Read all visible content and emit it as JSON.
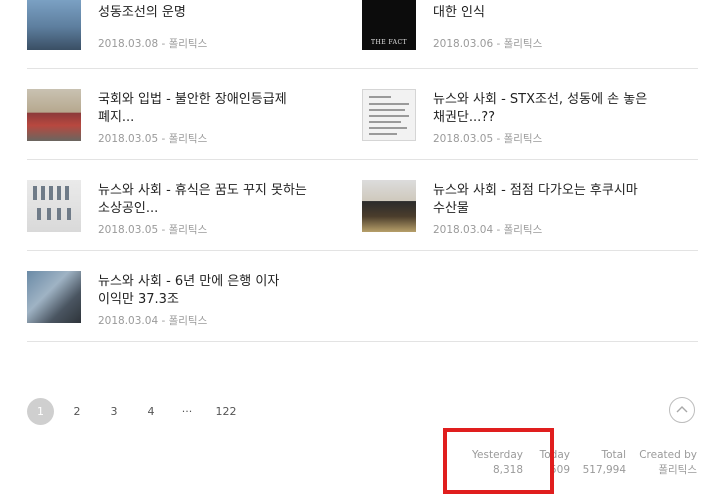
{
  "articles": [
    {
      "title": "성동조선의 운명",
      "date": "2018.03.08",
      "category": "폴리틱스",
      "thumb": "ship-photo"
    },
    {
      "title": "대한 인식",
      "date": "2018.03.06",
      "category": "폴리틱스",
      "thumb": "the-fact-photo",
      "thumb_caption": "THE FACT"
    },
    {
      "title": "국회와 입법 - 불안한 장애인등급제\n폐지...",
      "date": "2018.03.05",
      "category": "폴리틱스",
      "thumb": "protest-photo"
    },
    {
      "title": "뉴스와 사회 - STX조선, 성동에 손 놓은\n채권단...??",
      "date": "2018.03.05",
      "category": "폴리틱스",
      "thumb": "document-photo"
    },
    {
      "title": "뉴스와 사회 - 휴식은 꿈도 꾸지 못하는\n소상공인...",
      "date": "2018.03.05",
      "category": "폴리틱스",
      "thumb": "shop-photo"
    },
    {
      "title": "뉴스와 사회 - 점점 다가오는 후쿠시마\n수산물",
      "date": "2018.03.04",
      "category": "폴리틱스",
      "thumb": "fish-photo"
    },
    {
      "title": "뉴스와 사회 - 6년 만에 은행 이자\n이익만 37.3조",
      "date": "2018.03.04",
      "category": "폴리틱스",
      "thumb": "bank-photo"
    }
  ],
  "meta_separator": " - ",
  "pagination": {
    "pages": [
      "1",
      "2",
      "3",
      "4",
      "···",
      "122"
    ],
    "current": "1",
    "top_icon": "chevron-up-icon"
  },
  "counter": {
    "yesterday_label": "Yesterday",
    "yesterday_value": "8,318",
    "today_label": "Today",
    "today_value": "509",
    "total_label": "Total",
    "total_value": "517,994",
    "created_label": "Created by",
    "created_value": "폴리틱스"
  },
  "highlight_color": "#e01e1e"
}
